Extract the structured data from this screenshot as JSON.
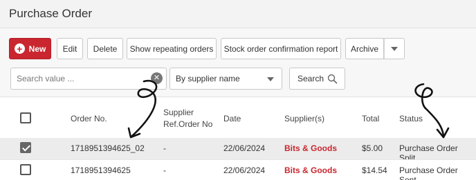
{
  "page": {
    "title": "Purchase Order"
  },
  "toolbar": {
    "new_label": "New",
    "edit_label": "Edit",
    "delete_label": "Delete",
    "show_repeating_label": "Show repeating orders",
    "stock_report_label": "Stock order confirmation report",
    "archive_label": "Archive"
  },
  "search": {
    "placeholder": "Search value ...",
    "value": "",
    "filter_selected": "By supplier name",
    "button_label": "Search"
  },
  "table": {
    "headers": {
      "order_no": "Order No.",
      "supplier_ref_line1": "Supplier",
      "supplier_ref_line2": "Ref.Order No",
      "date": "Date",
      "suppliers": "Supplier(s)",
      "total": "Total",
      "status": "Status"
    },
    "rows": [
      {
        "checked": true,
        "order_no": "1718951394625_02",
        "supplier_ref": "-",
        "date": "22/06/2024",
        "supplier": "Bits & Goods",
        "total": "$5.00",
        "status": "Purchase Order Split"
      },
      {
        "checked": false,
        "order_no": "1718951394625",
        "supplier_ref": "-",
        "date": "22/06/2024",
        "supplier": "Bits & Goods",
        "total": "$14.54",
        "status": "Purchase Order Sent"
      }
    ]
  },
  "colors": {
    "accent": "#c9262f",
    "selected_row": "#ececec"
  },
  "icons": [
    "plus-circle-icon",
    "chevron-down-icon",
    "clear-icon",
    "search-icon",
    "checkbox-icon"
  ]
}
